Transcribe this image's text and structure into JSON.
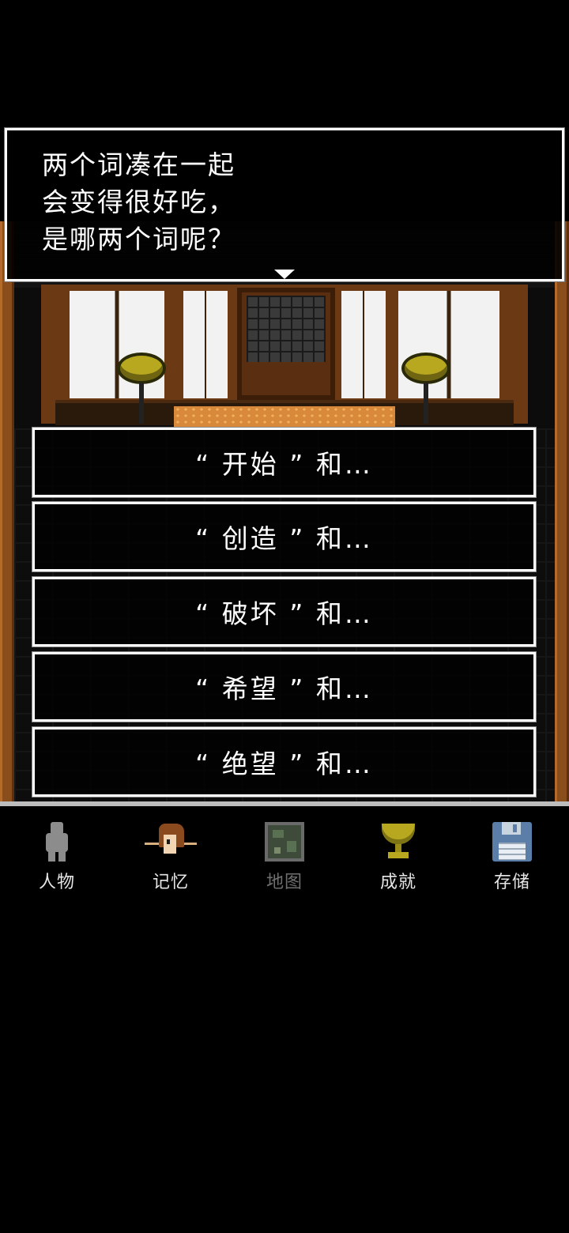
{
  "dialog": {
    "lines": [
      "两个词凑在一起",
      "会变得很好吃，",
      "是哪两个词呢？"
    ]
  },
  "choices": [
    {
      "label": "“ 开始 ” 和…"
    },
    {
      "label": "“ 创造 ” 和…"
    },
    {
      "label": "“ 破坏 ” 和…"
    },
    {
      "label": "“ 希望 ” 和…"
    },
    {
      "label": "“ 绝望 ” 和…"
    }
  ],
  "menu": {
    "items": [
      {
        "label": "人物",
        "icon": "person-icon",
        "enabled": true
      },
      {
        "label": "记忆",
        "icon": "memory-icon",
        "enabled": true
      },
      {
        "label": "地图",
        "icon": "map-icon",
        "enabled": false
      },
      {
        "label": "成就",
        "icon": "trophy-icon",
        "enabled": true
      },
      {
        "label": "存储",
        "icon": "save-icon",
        "enabled": true
      }
    ]
  },
  "colors": {
    "wood": "#8a4e1c",
    "trophy_gold": "#b8a820",
    "disabled_text": "#6f6f6f"
  }
}
